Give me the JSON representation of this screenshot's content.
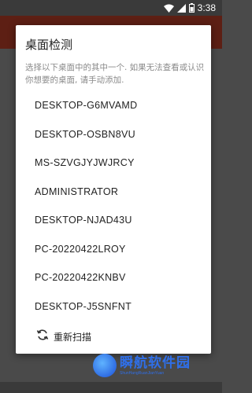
{
  "status_bar": {
    "time": "3:38",
    "icons": [
      "wifi-icon",
      "signal-icon",
      "battery-icon"
    ]
  },
  "dialog": {
    "title": "桌面检测",
    "description": "选择以下桌面中的其中一个. 如果无法查看或认识你想要的桌面, 请手动添加.",
    "machines": [
      "DESKTOP-G6MVAMD",
      "DESKTOP-OSBN8VU",
      "MS-SZVGJYJWJRCY",
      "ADMINISTRATOR",
      "DESKTOP-NJAD43U",
      "PC-20220422LROY",
      "PC-20220422KNBV",
      "DESKTOP-J5SNFNT"
    ],
    "rescan_label": "重新扫描"
  },
  "watermark": {
    "title": "瞬航软件园",
    "subtitle": "ShunHangRuanJianYuan"
  },
  "colors": {
    "app_bar": "#5d1f14",
    "background": "#4a4a4a",
    "dialog": "#ffffff",
    "watermark": "#2f6fe8"
  }
}
